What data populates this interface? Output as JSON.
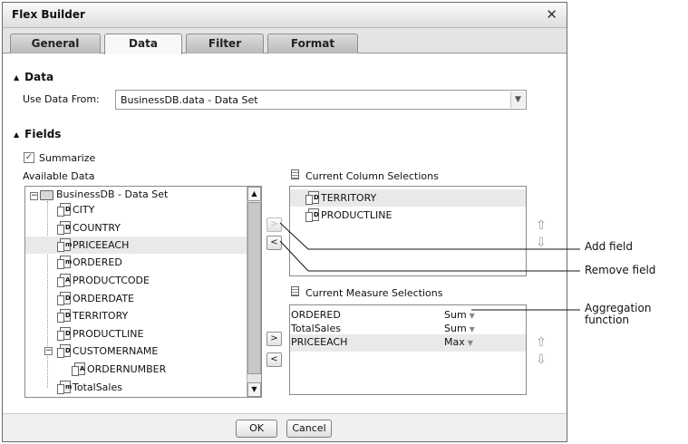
{
  "dialog": {
    "title": "Flex Builder"
  },
  "tabs": [
    {
      "label": "General"
    },
    {
      "label": "Data"
    },
    {
      "label": "Filter"
    },
    {
      "label": "Format"
    }
  ],
  "data_section": {
    "heading": "Data",
    "use_data_from_label": "Use Data From:",
    "use_data_from_value": "BusinessDB.data - Data Set"
  },
  "fields_section": {
    "heading": "Fields",
    "summarize_label": "Summarize",
    "summarize_checked": true,
    "available_label": "Available Data",
    "tree_root": "BusinessDB - Data Set",
    "available_items": [
      "CITY",
      "COUNTRY",
      "PRICEEACH",
      "ORDERED",
      "PRODUCTCODE",
      "ORDERDATE",
      "TERRITORY",
      "PRODUCTLINE",
      "CUSTOMERNAME",
      "ORDERNUMBER",
      "TotalSales"
    ],
    "column_label": "Current Column Selections",
    "column_items": [
      "TERRITORY",
      "PRODUCTLINE"
    ],
    "measure_label": "Current Measure Selections",
    "measure_items": [
      {
        "name": "ORDERED",
        "agg": "Sum"
      },
      {
        "name": "TotalSales",
        "agg": "Sum"
      },
      {
        "name": "PRICEEACH",
        "agg": "Max"
      }
    ]
  },
  "buttons": {
    "add": ">",
    "remove": "<",
    "ok": "OK",
    "cancel": "Cancel"
  },
  "annotations": {
    "add_field": "Add field",
    "remove_field": "Remove field",
    "aggregation_line1": "Aggregation",
    "aggregation_line2": "function"
  }
}
